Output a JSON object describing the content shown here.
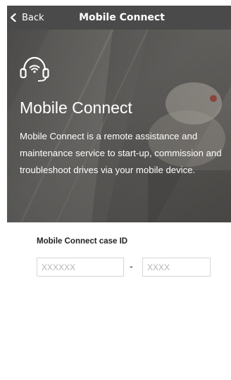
{
  "header": {
    "back_label": "Back",
    "title": "Mobile Connect"
  },
  "hero": {
    "icon": "headset-wifi-icon",
    "title": "Mobile Connect",
    "description": "Mobile Connect is a remote assistance and maintenance service to start-up, commission and troubleshoot drives via your mobile device."
  },
  "case_id": {
    "label": "Mobile Connect case ID",
    "field1": {
      "value": "",
      "placeholder": "XXXXXX"
    },
    "separator": "-",
    "field2": {
      "value": "",
      "placeholder": "XXXX"
    }
  },
  "colors": {
    "header_bg": "#4a4a4a",
    "text_light": "#ffffff",
    "input_border": "#d6d6d6",
    "placeholder": "#b5b5b5"
  }
}
